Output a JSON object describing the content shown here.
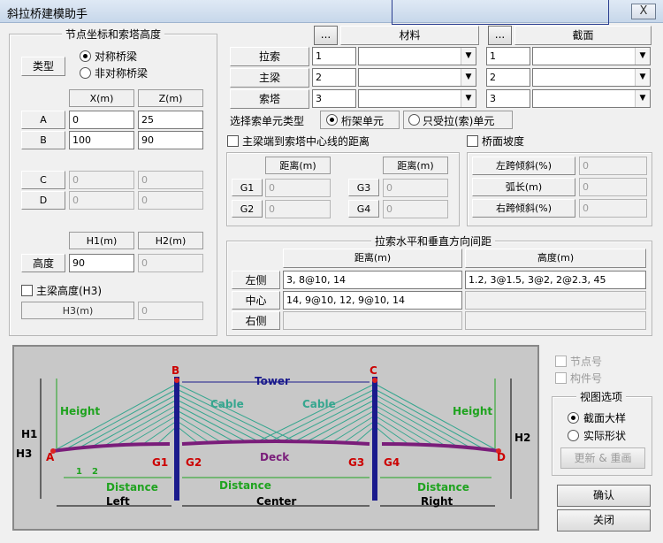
{
  "window": {
    "title": "斜拉桥建模助手",
    "close_label": "X"
  },
  "node_group": {
    "title": "节点坐标和索塔高度",
    "type_label": "类型",
    "radio_symmetric": "对称桥梁",
    "radio_asymmetric": "非对称桥梁",
    "col_x": "X(m)",
    "col_z": "Z(m)",
    "rows": [
      {
        "label": "A",
        "x": "0",
        "z": "25"
      },
      {
        "label": "B",
        "x": "100",
        "z": "90"
      },
      {
        "label": "C",
        "x": "0",
        "z": "0"
      },
      {
        "label": "D",
        "x": "0",
        "z": "0"
      }
    ],
    "col_h1": "H1(m)",
    "col_h2": "H2(m)",
    "height_label": "高度",
    "h1": "90",
    "h2": "0",
    "h3_check_label": "主梁高度(H3)",
    "h3_col": "H3(m)",
    "h3": "0"
  },
  "material_section": {
    "browse": "...",
    "material_header": "材料",
    "section_header": "截面",
    "rows": [
      {
        "label": "拉索",
        "mat": "1",
        "sec": "1"
      },
      {
        "label": "主梁",
        "mat": "2",
        "sec": "2"
      },
      {
        "label": "索塔",
        "mat": "3",
        "sec": "3"
      }
    ]
  },
  "cable_element": {
    "label": "选择索单元类型",
    "truss": "桁架单元",
    "tension_only": "只受拉(索)单元"
  },
  "distance_group": {
    "check_label": "主梁端到索塔中心线的距离",
    "col_dist": "距离(m)",
    "g1": "0",
    "g2": "0",
    "g3": "0",
    "g4": "0",
    "labels": [
      "G1",
      "G2",
      "G3",
      "G4"
    ]
  },
  "slope_group": {
    "check_label": "桥面坡度",
    "left_slope": "左跨倾斜(%)",
    "arc": "弧长(m)",
    "right_slope": "右跨倾斜(%)",
    "v1": "0",
    "v2": "0",
    "v3": "0"
  },
  "spacing_group": {
    "title": "拉索水平和垂直方向间距",
    "col_dist": "距离(m)",
    "col_height": "高度(m)",
    "left_label": "左侧",
    "center_label": "中心",
    "right_label": "右侧",
    "left_dist": "3, 8@10, 14",
    "left_height": "1.2, 3@1.5, 3@2, 2@2.3, 45",
    "center_dist": "14, 9@10, 12, 9@10, 14",
    "center_height": "",
    "right_dist": "",
    "right_height": ""
  },
  "diagram": {
    "tower": "Tower",
    "cable_left": "Cable",
    "cable_right": "Cable",
    "deck": "Deck",
    "height_left": "Height",
    "height_right": "Height",
    "b": "B",
    "c": "C",
    "a": "A",
    "d": "D",
    "h1": "H1",
    "h2": "H2",
    "h3": "H3",
    "g1": "G1",
    "g2": "G2",
    "g3": "G3",
    "g4": "G4",
    "distance": "Distance",
    "left": "Left",
    "center": "Center",
    "right": "Right",
    "tick1": "1",
    "tick2": "2"
  },
  "side_panel": {
    "node_no": "节点号",
    "elem_no": "构件号",
    "view_title": "视图选项",
    "view_sample": "截面大样",
    "view_real": "实际形状",
    "refresh": "更新 & 重画",
    "ok": "确认",
    "close": "关闭"
  }
}
